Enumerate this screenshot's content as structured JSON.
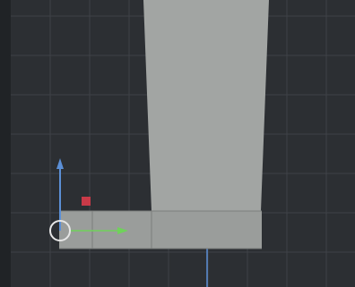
{
  "viewport": {
    "background_color": "#2c2f33",
    "edge_color": "#202326",
    "grid_color": "#3e4247",
    "mesh_face_color": "#a2a5a3",
    "mesh_face_shade_color": "#9a9d9b",
    "mesh_edge_color": "#7c7f7d",
    "gizmo_y_axis_color": "#5b8fd6",
    "gizmo_x_axis_color": "#6fd25a",
    "gizmo_marker_color": "#c93a48",
    "origin_ring_color": "#e6e6e6",
    "vertical_axis_color": "#5b8fd6"
  },
  "gizmo": {
    "icons": [
      "y-axis-arrow-icon",
      "x-axis-arrow-icon",
      "red-square-handle-icon",
      "origin-circle-icon"
    ]
  }
}
